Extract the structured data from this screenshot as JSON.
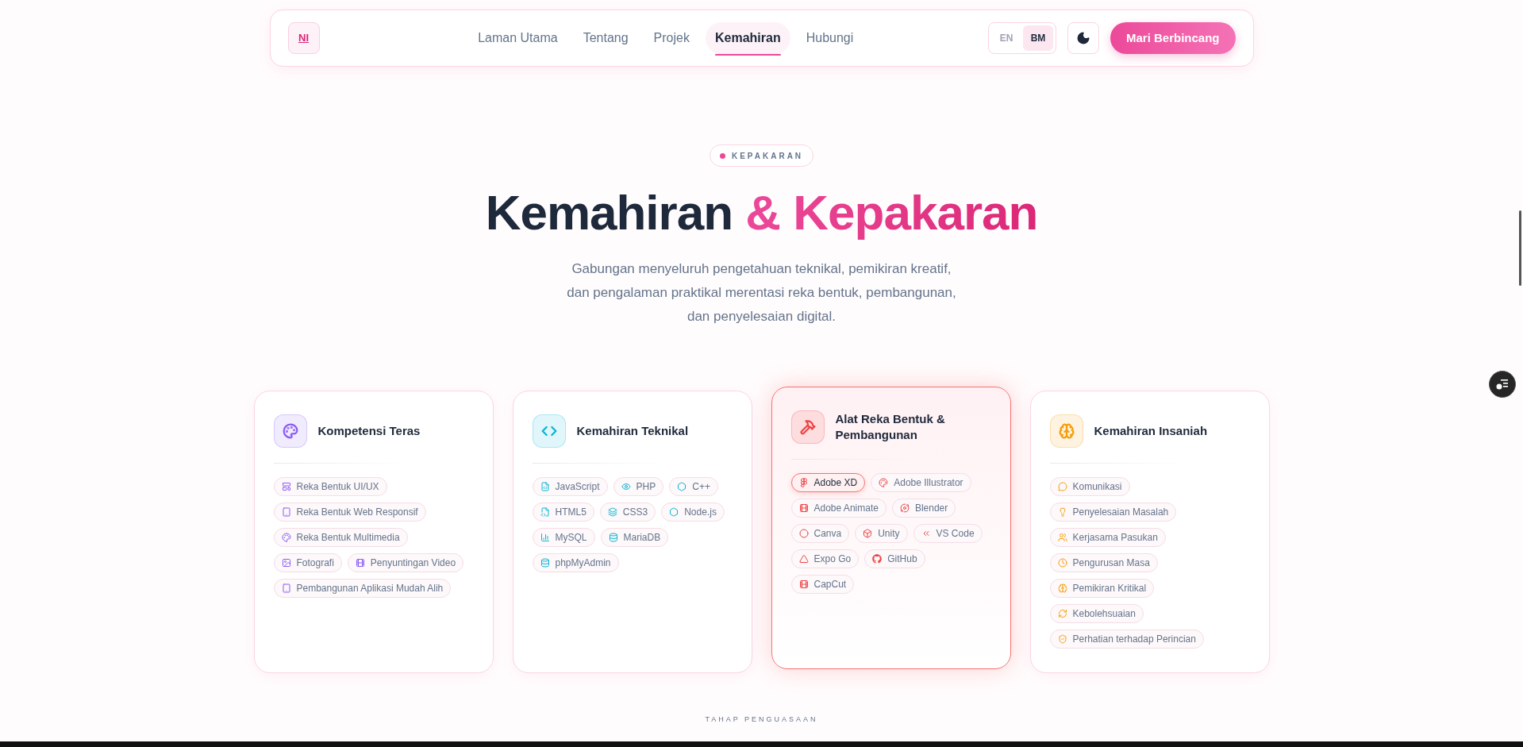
{
  "nav": {
    "logo": "NI",
    "links": [
      {
        "label": "Laman Utama",
        "selected": false
      },
      {
        "label": "Tentang",
        "selected": false
      },
      {
        "label": "Projek",
        "selected": false
      },
      {
        "label": "Kemahiran",
        "selected": true
      },
      {
        "label": "Hubungi",
        "selected": false
      }
    ],
    "languages": [
      {
        "label": "EN",
        "selected": false
      },
      {
        "label": "BM",
        "selected": true
      }
    ],
    "cta": "Mari Berbincang"
  },
  "section": {
    "badge": "KEPAKARAN",
    "title": "Kemahiran",
    "title_accent": "& Kepakaran",
    "description": "Gabungan menyeluruh pengetahuan teknikal, pemikiran kreatif, dan pengalaman praktikal merentasi reka bentuk, pembangunan, dan penyelesaian digital.",
    "cards": [
      {
        "title": "Kompetensi Teras",
        "color": "#8b5cf6",
        "highlighted": false,
        "skills": [
          {
            "label": "Reka Bentuk UI/UX",
            "highlighted": false
          },
          {
            "label": "Reka Bentuk Web Responsif",
            "highlighted": false
          },
          {
            "label": "Reka Bentuk Multimedia",
            "highlighted": false
          },
          {
            "label": "Fotografi",
            "highlighted": false
          },
          {
            "label": "Penyuntingan Video",
            "highlighted": false
          },
          {
            "label": "Pembangunan Aplikasi Mudah Alih",
            "highlighted": false
          }
        ]
      },
      {
        "title": "Kemahiran Teknikal",
        "color": "#06b6d4",
        "highlighted": false,
        "skills": [
          {
            "label": "JavaScript",
            "highlighted": false
          },
          {
            "label": "PHP",
            "highlighted": false
          },
          {
            "label": "C++",
            "highlighted": false
          },
          {
            "label": "HTML5",
            "highlighted": false
          },
          {
            "label": "CSS3",
            "highlighted": false
          },
          {
            "label": "Node.js",
            "highlighted": false
          },
          {
            "label": "MySQL",
            "highlighted": false
          },
          {
            "label": "MariaDB",
            "highlighted": false
          },
          {
            "label": "phpMyAdmin",
            "highlighted": false
          }
        ]
      },
      {
        "title": "Alat Reka Bentuk & Pembangunan",
        "color": "#ef4444",
        "highlighted": true,
        "skills": [
          {
            "label": "Adobe XD",
            "highlighted": true
          },
          {
            "label": "Adobe Illustrator",
            "highlighted": false
          },
          {
            "label": "Adobe Animate",
            "highlighted": false
          },
          {
            "label": "Blender",
            "highlighted": false
          },
          {
            "label": "Canva",
            "highlighted": false
          },
          {
            "label": "Unity",
            "highlighted": false
          },
          {
            "label": "VS Code",
            "highlighted": false
          },
          {
            "label": "Expo Go",
            "highlighted": false
          },
          {
            "label": "GitHub",
            "highlighted": false
          },
          {
            "label": "CapCut",
            "highlighted": false
          }
        ]
      },
      {
        "title": "Kemahiran Insaniah",
        "color": "#f59e0b",
        "highlighted": false,
        "skills": [
          {
            "label": "Komunikasi",
            "highlighted": false
          },
          {
            "label": "Penyelesaian Masalah",
            "highlighted": false
          },
          {
            "label": "Kerjasama Pasukan",
            "highlighted": false
          },
          {
            "label": "Pengurusan Masa",
            "highlighted": false
          },
          {
            "label": "Pemikiran Kritikal",
            "highlighted": false
          },
          {
            "label": "Kebolehsuaian",
            "highlighted": false
          },
          {
            "label": "Perhatian terhadap Perincian",
            "highlighted": false
          }
        ]
      }
    ],
    "footer_label": "TAHAP PENGUASAAN"
  }
}
